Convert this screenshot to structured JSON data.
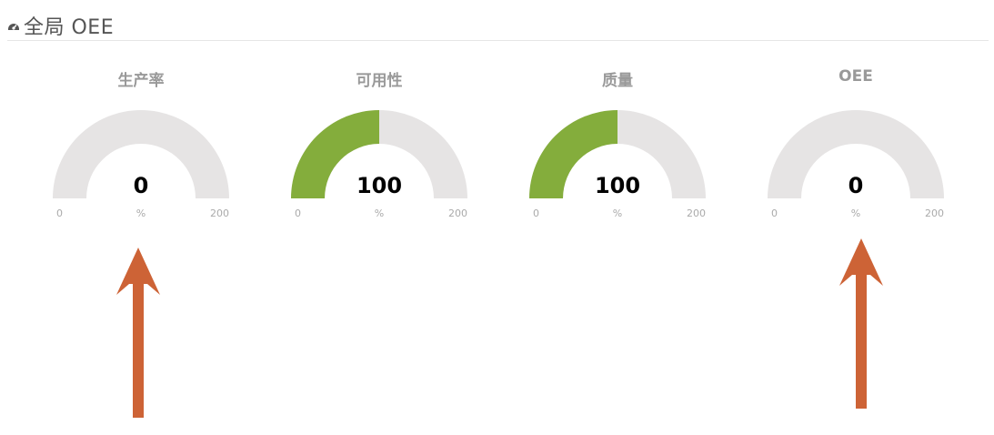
{
  "header": {
    "title": "全局 OEE",
    "icon": "dashboard-icon"
  },
  "gauges": [
    {
      "title": "生产率",
      "value": "0",
      "level": 0,
      "min": "0",
      "max": "200",
      "unit": "%"
    },
    {
      "title": "可用性",
      "value": "100",
      "level": 100,
      "min": "0",
      "max": "200",
      "unit": "%"
    },
    {
      "title": "质量",
      "value": "100",
      "level": 100,
      "min": "0",
      "max": "200",
      "unit": "%"
    },
    {
      "title": "OEE",
      "value": "0",
      "level": 0,
      "min": "0",
      "max": "200",
      "unit": "%"
    }
  ],
  "colors": {
    "fill": "#84ad3c",
    "track": "#e6e4e4",
    "arrow": "#cd6336"
  },
  "annotations": [
    "arrow-up",
    "arrow-up"
  ]
}
